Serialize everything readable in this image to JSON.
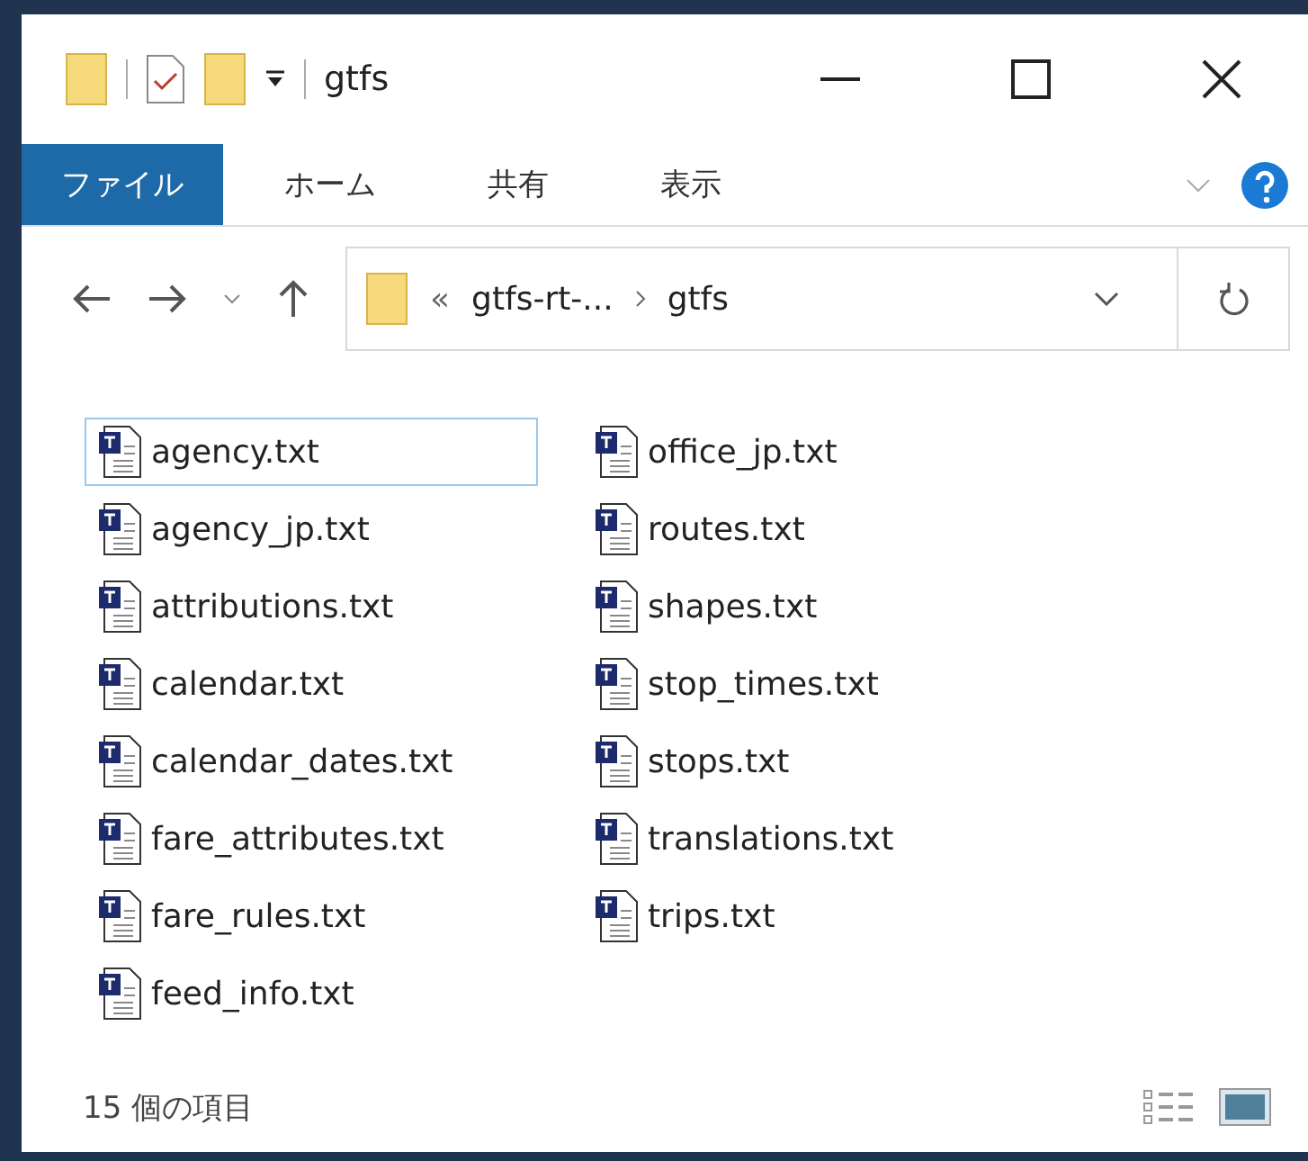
{
  "window": {
    "title": "gtfs"
  },
  "ribbon_tabs": [
    {
      "label": "ファイル",
      "kind": "file"
    },
    {
      "label": "ホーム",
      "kind": "tab"
    },
    {
      "label": "共有",
      "kind": "tab"
    },
    {
      "label": "表示",
      "kind": "tab"
    }
  ],
  "address_bar": {
    "overflow": "«",
    "path": [
      "gtfs-rt-...",
      "gtfs"
    ]
  },
  "files": [
    {
      "name": "agency.txt",
      "focused": true
    },
    {
      "name": "agency_jp.txt",
      "focused": false
    },
    {
      "name": "attributions.txt",
      "focused": false
    },
    {
      "name": "calendar.txt",
      "focused": false
    },
    {
      "name": "calendar_dates.txt",
      "focused": false
    },
    {
      "name": "fare_attributes.txt",
      "focused": false
    },
    {
      "name": "fare_rules.txt",
      "focused": false
    },
    {
      "name": "feed_info.txt",
      "focused": false
    },
    {
      "name": "office_jp.txt",
      "focused": false
    },
    {
      "name": "routes.txt",
      "focused": false
    },
    {
      "name": "shapes.txt",
      "focused": false
    },
    {
      "name": "stop_times.txt",
      "focused": false
    },
    {
      "name": "stops.txt",
      "focused": false
    },
    {
      "name": "translations.txt",
      "focused": false
    },
    {
      "name": "trips.txt",
      "focused": false
    }
  ],
  "status_bar": {
    "item_count": "15 個の項目"
  }
}
